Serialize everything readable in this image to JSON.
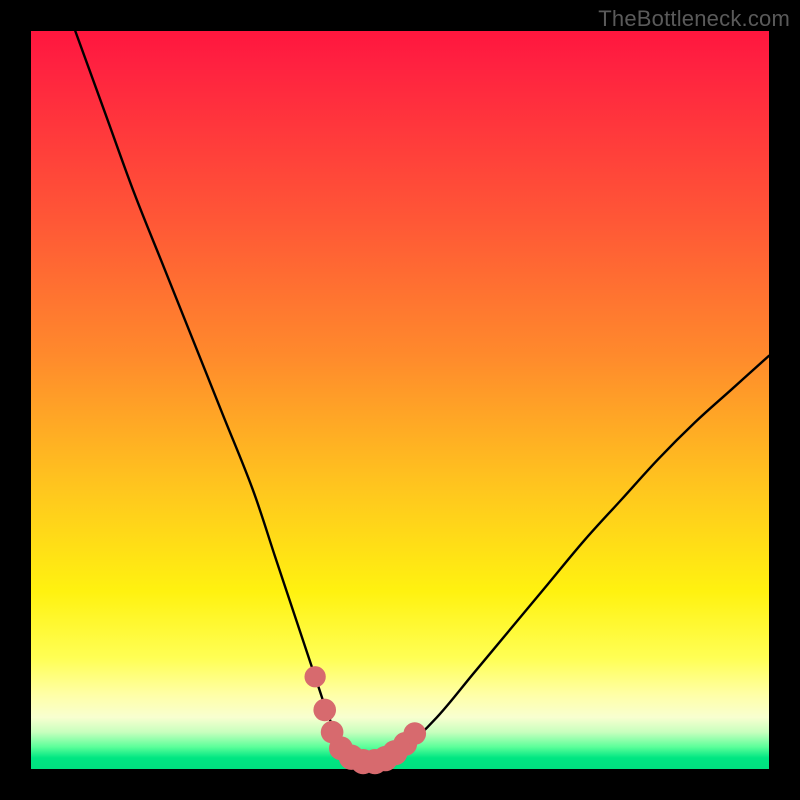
{
  "watermark": "TheBottleneck.com",
  "chart_data": {
    "type": "line",
    "title": "",
    "xlabel": "",
    "ylabel": "",
    "xlim": [
      0,
      100
    ],
    "ylim": [
      0,
      100
    ],
    "series": [
      {
        "name": "bottleneck-curve",
        "x": [
          6,
          10,
          14,
          18,
          22,
          26,
          30,
          33,
          35,
          37,
          39,
          40,
          41,
          42,
          43,
          44,
          45,
          46,
          47,
          48,
          50,
          55,
          60,
          65,
          70,
          75,
          80,
          85,
          90,
          95,
          100
        ],
        "values": [
          100,
          89,
          78,
          68,
          58,
          48,
          38,
          29,
          23,
          17,
          11,
          8,
          5.5,
          3.5,
          2.2,
          1.4,
          1.0,
          1.0,
          1.0,
          1.2,
          2.2,
          7,
          13,
          19,
          25,
          31,
          36.5,
          42,
          47,
          51.5,
          56
        ]
      }
    ],
    "markers": {
      "name": "trough-markers",
      "color": "#d76a6e",
      "points": [
        {
          "x": 38.5,
          "y": 12.5,
          "r": 1.0
        },
        {
          "x": 39.8,
          "y": 8.0,
          "r": 1.1
        },
        {
          "x": 40.8,
          "y": 5.0,
          "r": 1.1
        },
        {
          "x": 42.0,
          "y": 2.8,
          "r": 1.2
        },
        {
          "x": 43.4,
          "y": 1.6,
          "r": 1.3
        },
        {
          "x": 45.0,
          "y": 1.0,
          "r": 1.3
        },
        {
          "x": 46.6,
          "y": 1.0,
          "r": 1.3
        },
        {
          "x": 48.0,
          "y": 1.4,
          "r": 1.3
        },
        {
          "x": 49.3,
          "y": 2.2,
          "r": 1.3
        },
        {
          "x": 50.7,
          "y": 3.4,
          "r": 1.2
        },
        {
          "x": 52.0,
          "y": 4.8,
          "r": 1.1
        }
      ]
    },
    "gradient_stops": [
      {
        "pos": 0.0,
        "color": "#ff163e"
      },
      {
        "pos": 0.26,
        "color": "#ff5836"
      },
      {
        "pos": 0.44,
        "color": "#ff8a2c"
      },
      {
        "pos": 0.62,
        "color": "#ffc61e"
      },
      {
        "pos": 0.76,
        "color": "#fff210"
      },
      {
        "pos": 0.9,
        "color": "#ffffa8"
      },
      {
        "pos": 0.95,
        "color": "#c8ffbe"
      },
      {
        "pos": 1.0,
        "color": "#00e080"
      }
    ]
  }
}
